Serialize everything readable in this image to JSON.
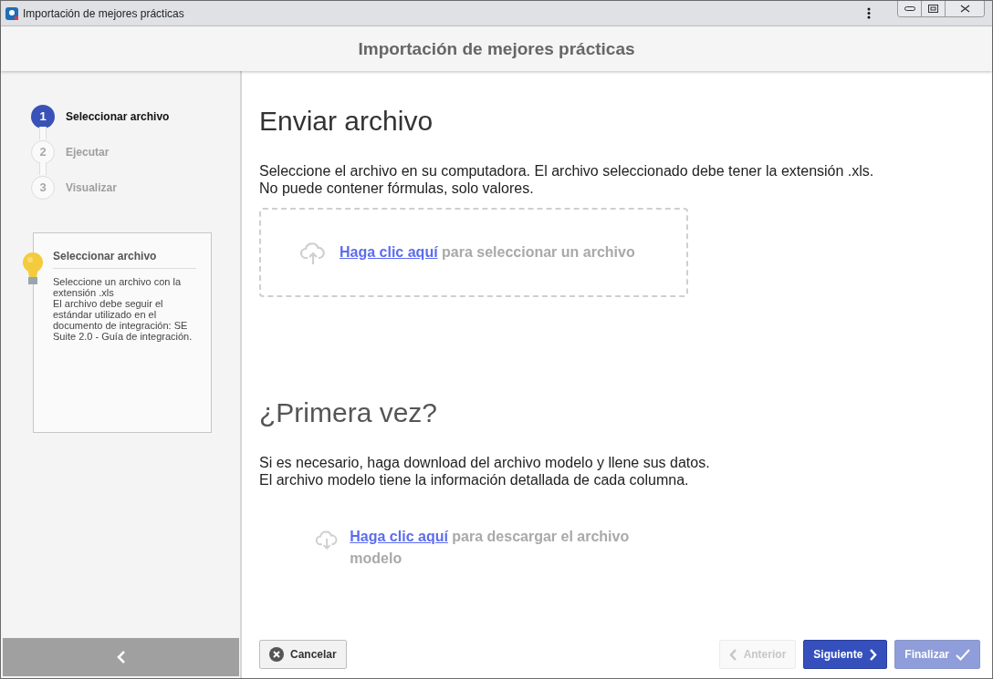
{
  "window": {
    "title": "Importación de mejores prácticas"
  },
  "header": {
    "title": "Importación de mejores prácticas"
  },
  "steps": [
    {
      "number": "1",
      "label": "Seleccionar archivo",
      "selected": true
    },
    {
      "number": "2",
      "label": "Ejecutar",
      "selected": false
    },
    {
      "number": "3",
      "label": "Visualizar",
      "selected": false
    }
  ],
  "tip": {
    "title": "Seleccionar archivo",
    "paragraphs": [
      "Seleccione un archivo con la extensión .xls",
      "El archivo debe seguir el estándar utilizado en el documento de integración: SE Suite 2.0 - Guía de integración."
    ]
  },
  "upload": {
    "title": "Enviar archivo",
    "description": [
      "Seleccione el archivo en su computadora. El archivo seleccionado debe tener la extensión .xls.",
      "No puede contener fórmulas, solo valores."
    ],
    "link": "Haga clic aquí",
    "rest": "para seleccionar un archivo"
  },
  "first_time": {
    "title": "¿Primera vez?",
    "description": [
      "Si es necesario, haga download del archivo modelo y llene sus datos.",
      "El archivo modelo tiene la información detallada de cada columna."
    ],
    "link": "Haga clic aquí",
    "rest": "para descargar el archivo modelo"
  },
  "footer": {
    "buttons": [
      {
        "kind": "cancel",
        "label": "Cancelar",
        "disabled": false
      },
      {
        "kind": "back",
        "label": "Anterior",
        "disabled": true
      },
      {
        "kind": "next",
        "label": "Siguiente",
        "disabled": false
      },
      {
        "kind": "finish",
        "label": "Finalizar",
        "disabled": true
      }
    ]
  }
}
